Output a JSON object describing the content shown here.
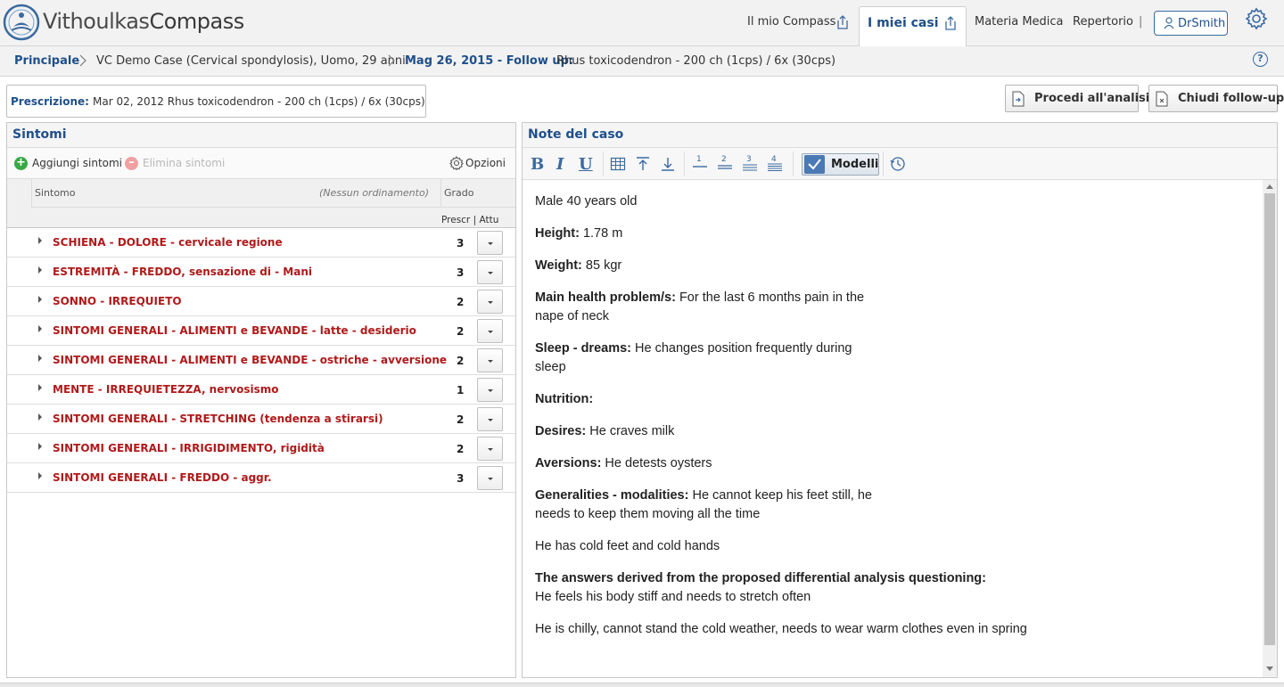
{
  "app": {
    "logo_text_light": "Vithoulkas",
    "logo_text_bold": "Compass"
  },
  "nav": {
    "il_mio_compass": "Il mio Compass",
    "i_miei_casi": "I miei casi",
    "materia_medica": "Materia Medica",
    "repertorio": "Repertorio",
    "separator": "|",
    "user": "DrSmith"
  },
  "breadcrumb": {
    "home": "Principale",
    "case": "VC Demo Case (Cervical spondylosis), Uomo, 29 anni",
    "followup_date": "Mag 26, 2015 - Follow up:",
    "followup_rx": "Rhus toxicodendron - 200 ch (1cps) / 6x (30cps)",
    "help": "?"
  },
  "prescription": {
    "label": "Prescrizione:",
    "value": "Mar 02, 2012 Rhus toxicodendron - 200 ch (1cps) / 6x (30cps)"
  },
  "actions": {
    "analyze": "Procedi all'analisi",
    "close_followup": "Chiudi follow-up"
  },
  "symptoms_panel": {
    "title": "Sintomi",
    "add": "Aggiungi sintomi",
    "delete": "Elimina sintomi",
    "options": "Opzioni",
    "col_symptom": "Sintomo",
    "col_sort": "(Nessun ordinamento)",
    "col_grade": "Grado",
    "col_prescr": "Prescr | Attu",
    "rows": [
      {
        "symptom": "SCHIENA - DOLORE - cervicale regione",
        "grade": "3"
      },
      {
        "symptom": "ESTREMITÀ - FREDDO, sensazione di - Mani",
        "grade": "3"
      },
      {
        "symptom": "SONNO - IRREQUIETO",
        "grade": "2"
      },
      {
        "symptom": "SINTOMI GENERALI - ALIMENTI e BEVANDE - latte - desiderio",
        "grade": "2"
      },
      {
        "symptom": "SINTOMI GENERALI - ALIMENTI e BEVANDE - ostriche - avversione",
        "grade": "2"
      },
      {
        "symptom": "MENTE - IRREQUIETEZZA, nervosismo",
        "grade": "1"
      },
      {
        "symptom": "SINTOMI GENERALI - STRETCHING (tendenza a stirarsi)",
        "grade": "2"
      },
      {
        "symptom": "SINTOMI GENERALI - IRRIGIDIMENTO, rigidità",
        "grade": "2"
      },
      {
        "symptom": "SINTOMI GENERALI - FREDDO - aggr.",
        "grade": "3"
      }
    ]
  },
  "notes_panel": {
    "title": "Note del caso",
    "toolbar": {
      "bold": "B",
      "italic": "I",
      "underline": "U",
      "modelli": "Modelli",
      "h1": "1",
      "h2": "2",
      "h3": "3",
      "h4": "4"
    },
    "notes": {
      "intro": "Male 40 years old",
      "height_label": "Height:",
      "height_value": " 1.78 m",
      "weight_label": "Weight:",
      "weight_value": " 85 kgr",
      "main_label": "Main health problem/s:",
      "main_value": " For the last 6 months pain in the nape of neck",
      "sleep_label": "Sleep - dreams:",
      "sleep_value": " He changes position frequently during sleep",
      "nutrition_label": "Nutrition:",
      "desires_label": "Desires:",
      "desires_value": " He craves milk",
      "aversions_label": "Aversions:",
      "aversions_value": " He detests oysters",
      "gen_label": "Generalities - modalities:",
      "gen_value": " He cannot keep his feet still, he needs to keep them moving all the time",
      "cold": "He has cold feet and cold hands",
      "answers_label": "The answers derived from the proposed differential analysis questioning:",
      "answers_value": "He feels his body stiff and needs to stretch often",
      "chilly": "He is chilly, cannot stand the cold weather, needs to wear warm clothes even in spring"
    }
  },
  "colors": {
    "brand_blue": "#1f4f8a",
    "symptom_red": "#b01a1a",
    "add_green": "#3aa845"
  }
}
